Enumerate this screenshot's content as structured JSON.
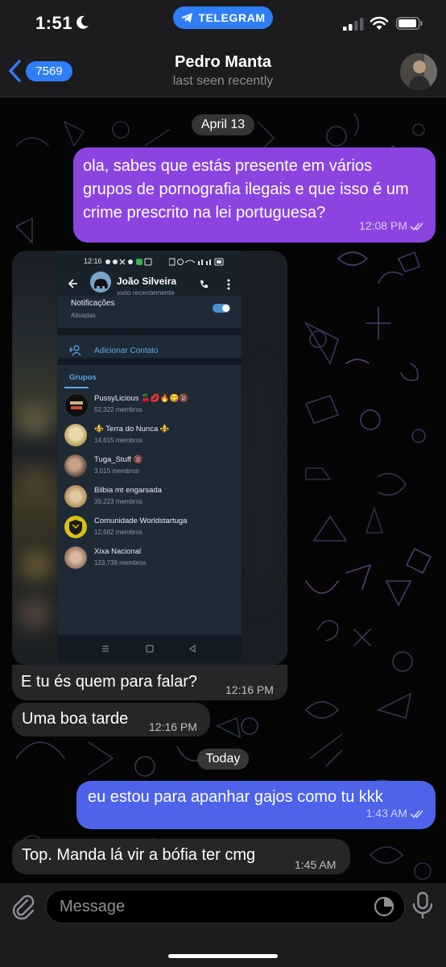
{
  "status_bar": {
    "time": "1:51",
    "pill_label": "TELEGRAM"
  },
  "header": {
    "back_count": "7569",
    "contact_name": "Pedro Manta",
    "contact_status": "last seen recently"
  },
  "colors": {
    "outgoing_purple": "#8b44e0",
    "outgoing_blue": "#4d63ea",
    "incoming": "#262628",
    "accent": "#2f7ef5"
  },
  "messages": [
    {
      "kind": "date",
      "text": "April 13"
    },
    {
      "kind": "outgoing",
      "text": "ola, sabes que estás presente em vários grupos de pornografia ilegais e que isso é um crime prescrito na lei portuguesa?",
      "time": "12:08 PM",
      "read": true
    },
    {
      "kind": "incoming-image",
      "description": "screenshot"
    },
    {
      "kind": "incoming",
      "text": "E tu és quem para falar?",
      "time": "12:16 PM"
    },
    {
      "kind": "incoming",
      "text": "Uma boa tarde",
      "time": "12:16 PM"
    },
    {
      "kind": "date",
      "text": "Today"
    },
    {
      "kind": "outgoing",
      "text": "eu estou para apanhar gajos como tu kkk",
      "time": "1:43 AM",
      "read": true
    },
    {
      "kind": "incoming",
      "text": "Top. Manda lá vir a bófia ter cmg",
      "time": "1:45 AM"
    }
  ],
  "screenshot": {
    "status_time": "12:16",
    "contact_name": "João Silveira",
    "contact_status": "visto recentemente",
    "notifications_label": "Notificações",
    "notifications_value": "Ativadas",
    "add_contact": "Adicionar Contato",
    "groups_header": "Grupos",
    "groups": [
      {
        "title": "PussyLicious 🍒💋🔥😋🔞",
        "members": "52,322 membros"
      },
      {
        "title": "⚜️ Terra do Nunca ⚜️",
        "members": "14,615 membros"
      },
      {
        "title": "Tuga_Stuff 🔞",
        "members": "3,015 membros"
      },
      {
        "title": "Bilbia mt engarsada",
        "members": "39,223 membros"
      },
      {
        "title": "Comunidade Worldstartuga",
        "members": "12,682 membros"
      },
      {
        "title": "Xixa Nacional",
        "members": "123,739 membros"
      }
    ]
  },
  "input": {
    "placeholder": "Message"
  }
}
